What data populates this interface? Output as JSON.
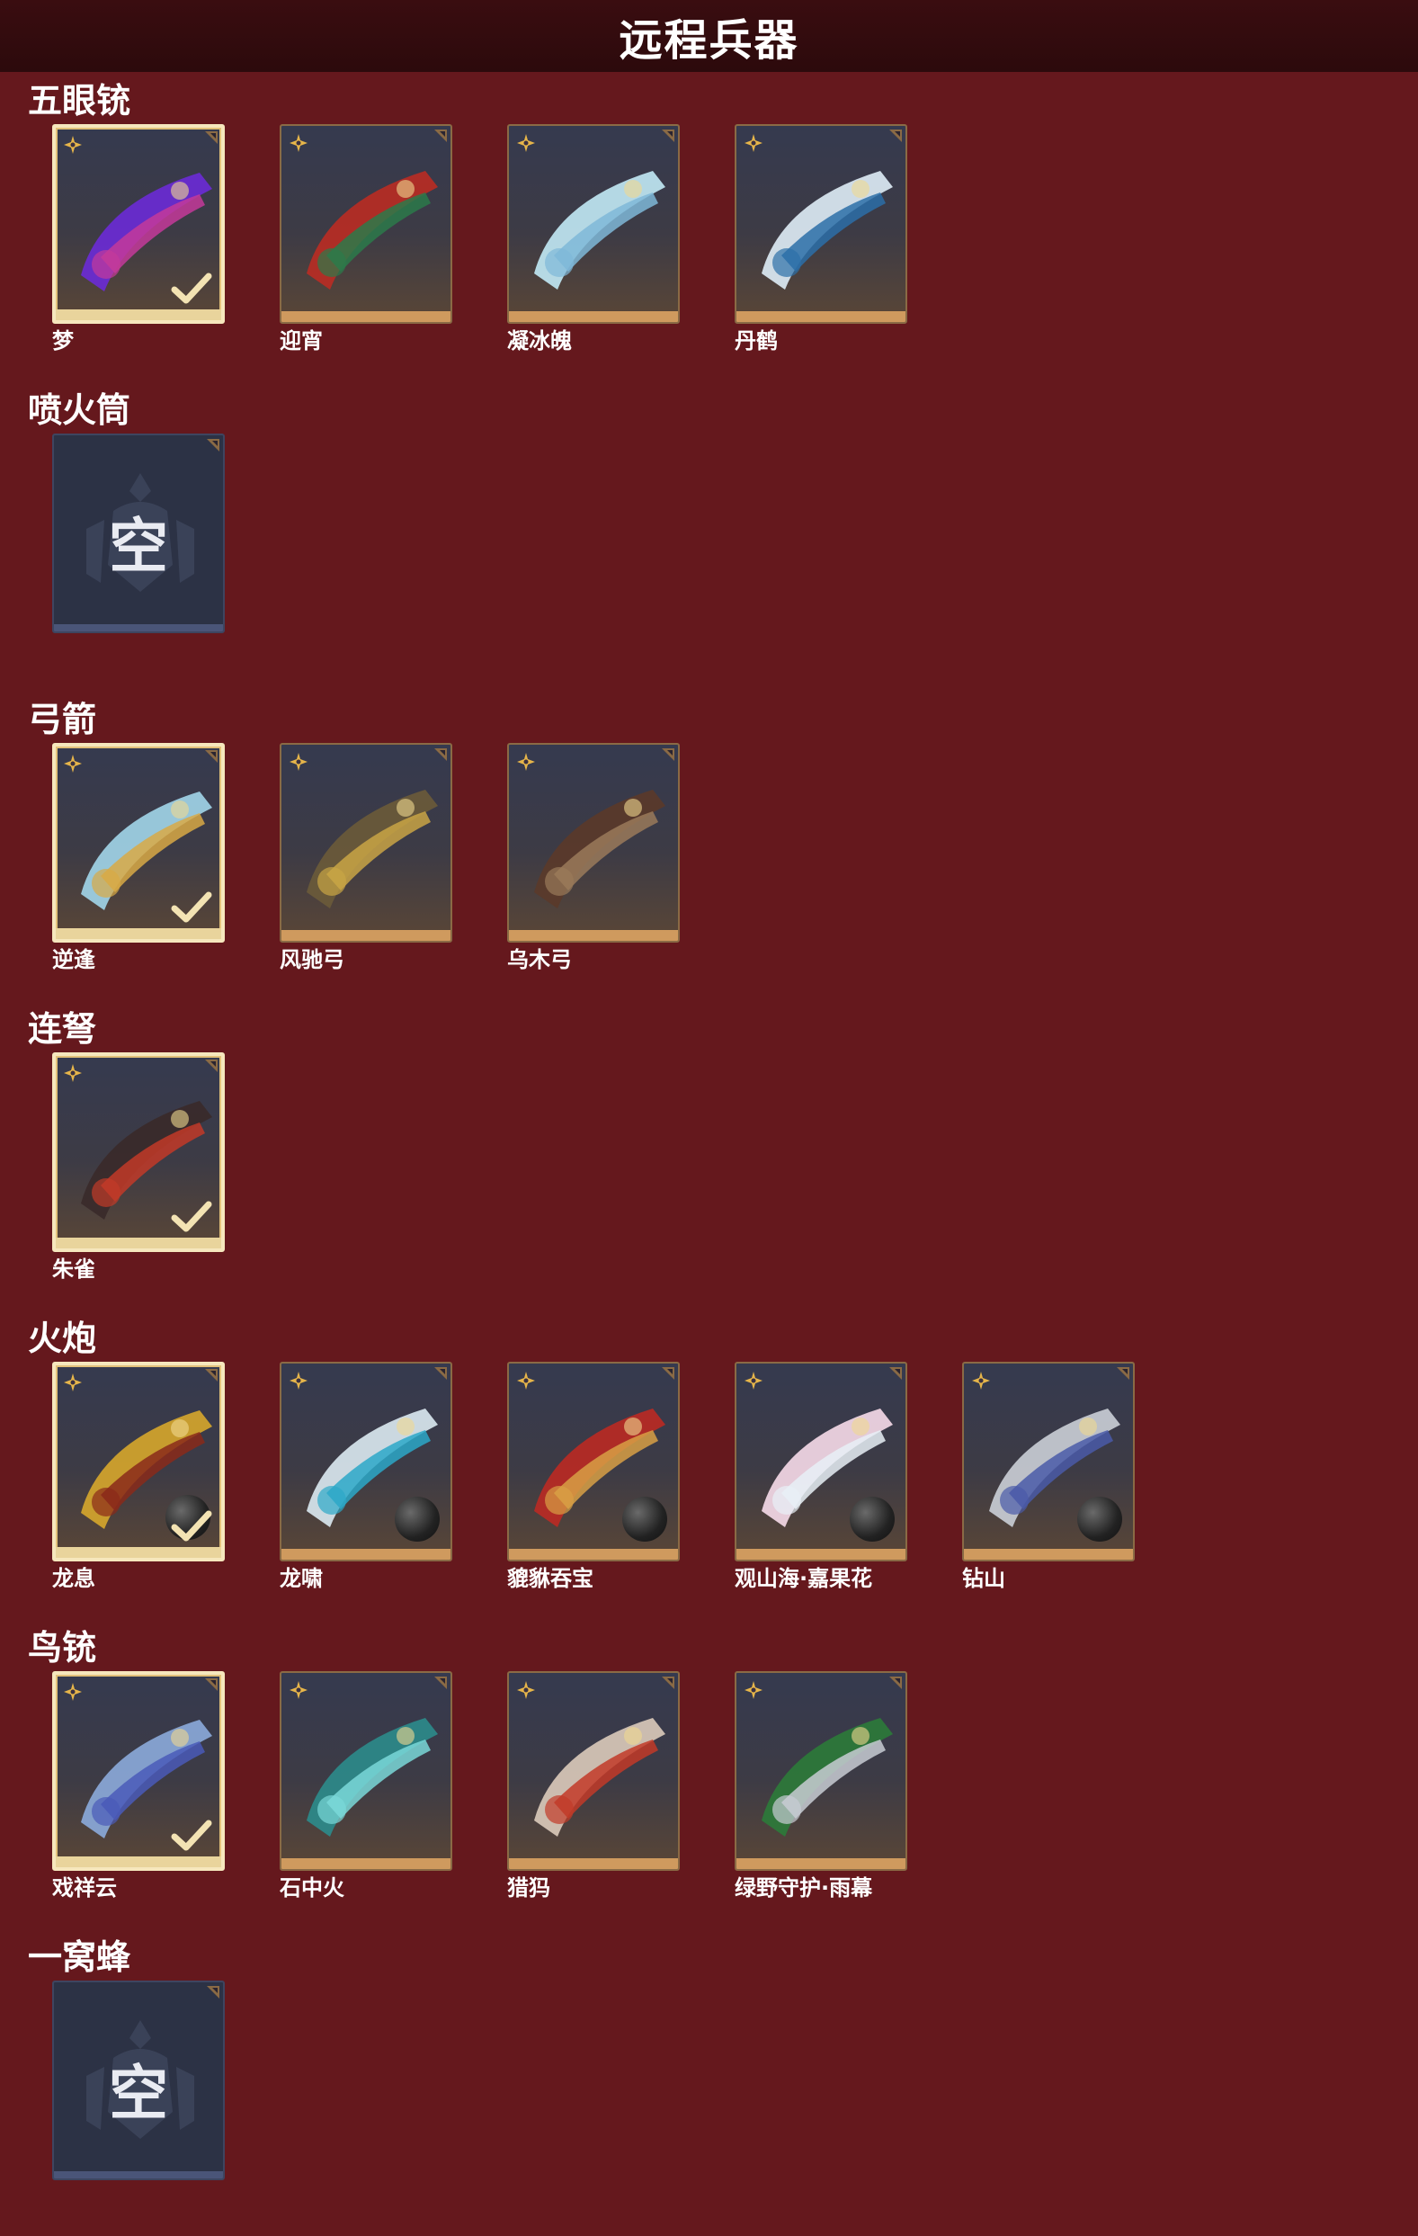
{
  "page": {
    "title": "远程兵器"
  },
  "colors": {
    "background": "#65181d",
    "title_bar": "#2c0a0c",
    "equipped_border": "#f6e7bd",
    "slot_border": "#cf9a5e"
  },
  "categories": [
    {
      "name": "五眼铳",
      "items": [
        {
          "name": "梦",
          "equipped": true,
          "palette": [
            "#6a2bd4",
            "#c43a9a"
          ]
        },
        {
          "name": "迎宵",
          "equipped": false,
          "palette": [
            "#b72c24",
            "#2c7a4a"
          ]
        },
        {
          "name": "凝冰魄",
          "equipped": false,
          "palette": [
            "#bfe6f2",
            "#7fb8d8"
          ]
        },
        {
          "name": "丹鹤",
          "equipped": false,
          "palette": [
            "#dbe9f3",
            "#2c6fa8"
          ]
        }
      ]
    },
    {
      "name": "喷火筒",
      "empty": true,
      "empty_label": "空"
    },
    {
      "name": "弓箭",
      "items": [
        {
          "name": "逆逢",
          "equipped": true,
          "palette": [
            "#9fd3e6",
            "#d8a945"
          ]
        },
        {
          "name": "风驰弓",
          "equipped": false,
          "palette": [
            "#6a5a3a",
            "#c9a545"
          ]
        },
        {
          "name": "乌木弓",
          "equipped": false,
          "palette": [
            "#5a3a2a",
            "#9a7a5a"
          ]
        }
      ]
    },
    {
      "name": "连弩",
      "items": [
        {
          "name": "朱雀",
          "equipped": true,
          "palette": [
            "#3a2a2a",
            "#c23a28"
          ]
        }
      ]
    },
    {
      "name": "火炮",
      "items": [
        {
          "name": "龙息",
          "equipped": true,
          "palette": [
            "#d4a52c",
            "#8a2a1a"
          ],
          "ammo": true
        },
        {
          "name": "龙啸",
          "equipped": false,
          "palette": [
            "#d8e6ee",
            "#2ca8c8"
          ],
          "ammo": true
        },
        {
          "name": "貔貅吞宝",
          "equipped": false,
          "palette": [
            "#b82a24",
            "#d8a045"
          ],
          "ammo": true
        },
        {
          "name": "观山海·嘉果花",
          "equipped": false,
          "palette": [
            "#f3d8e6",
            "#e8f0f6"
          ],
          "ammo": true
        },
        {
          "name": "钻山",
          "equipped": false,
          "palette": [
            "#c8ccd4",
            "#4a5aa8"
          ],
          "ammo": true
        }
      ]
    },
    {
      "name": "鸟铳",
      "items": [
        {
          "name": "戏祥云",
          "equipped": true,
          "palette": [
            "#8aa8d8",
            "#4a5ab8"
          ]
        },
        {
          "name": "石中火",
          "equipped": false,
          "palette": [
            "#2c8a8a",
            "#7ad8d8"
          ]
        },
        {
          "name": "猎犸",
          "equipped": false,
          "palette": [
            "#d8c8b8",
            "#c23a28"
          ]
        },
        {
          "name": "绿野守护·雨幕",
          "equipped": false,
          "palette": [
            "#2c7a3a",
            "#c8ccd4"
          ]
        }
      ]
    },
    {
      "name": "一窝蜂",
      "empty": true,
      "empty_label": "空"
    }
  ]
}
